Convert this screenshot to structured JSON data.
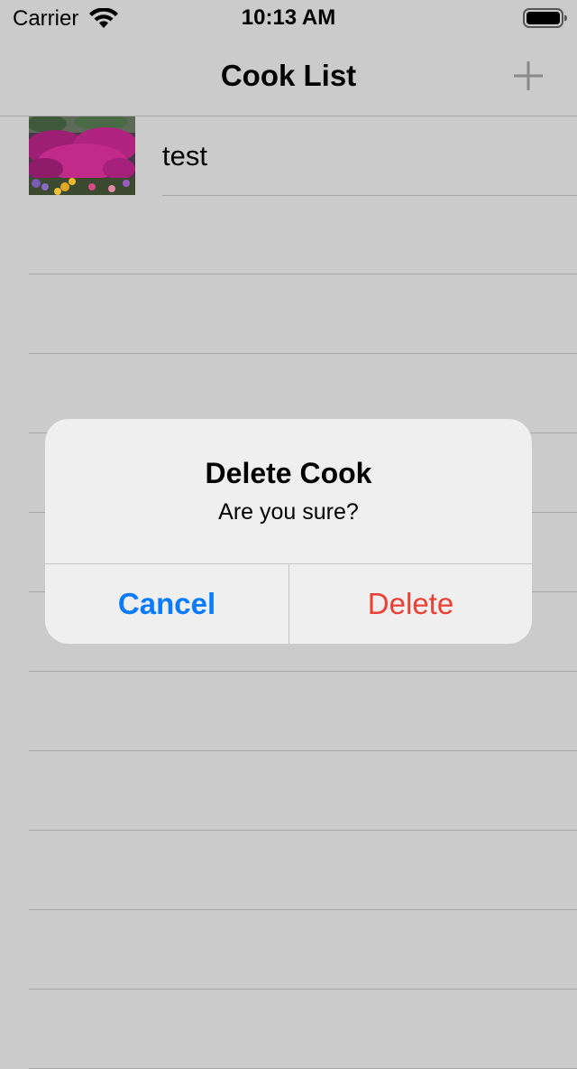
{
  "status_bar": {
    "carrier": "Carrier",
    "time": "10:13 AM",
    "wifi_icon": "wifi-icon",
    "battery_icon": "battery-full-icon"
  },
  "nav": {
    "title": "Cook List",
    "add_icon": "plus-icon"
  },
  "list": {
    "items": [
      {
        "label": "test",
        "thumbnail": "flower-photo"
      }
    ]
  },
  "alert": {
    "title": "Delete Cook",
    "message": "Are you sure?",
    "cancel_label": "Cancel",
    "delete_label": "Delete"
  },
  "colors": {
    "background": "#cbcbcb",
    "alert_background": "#efefef",
    "cancel": "#0a7aff",
    "destructive": "#eb4034",
    "separator": "#a9a9a9"
  }
}
